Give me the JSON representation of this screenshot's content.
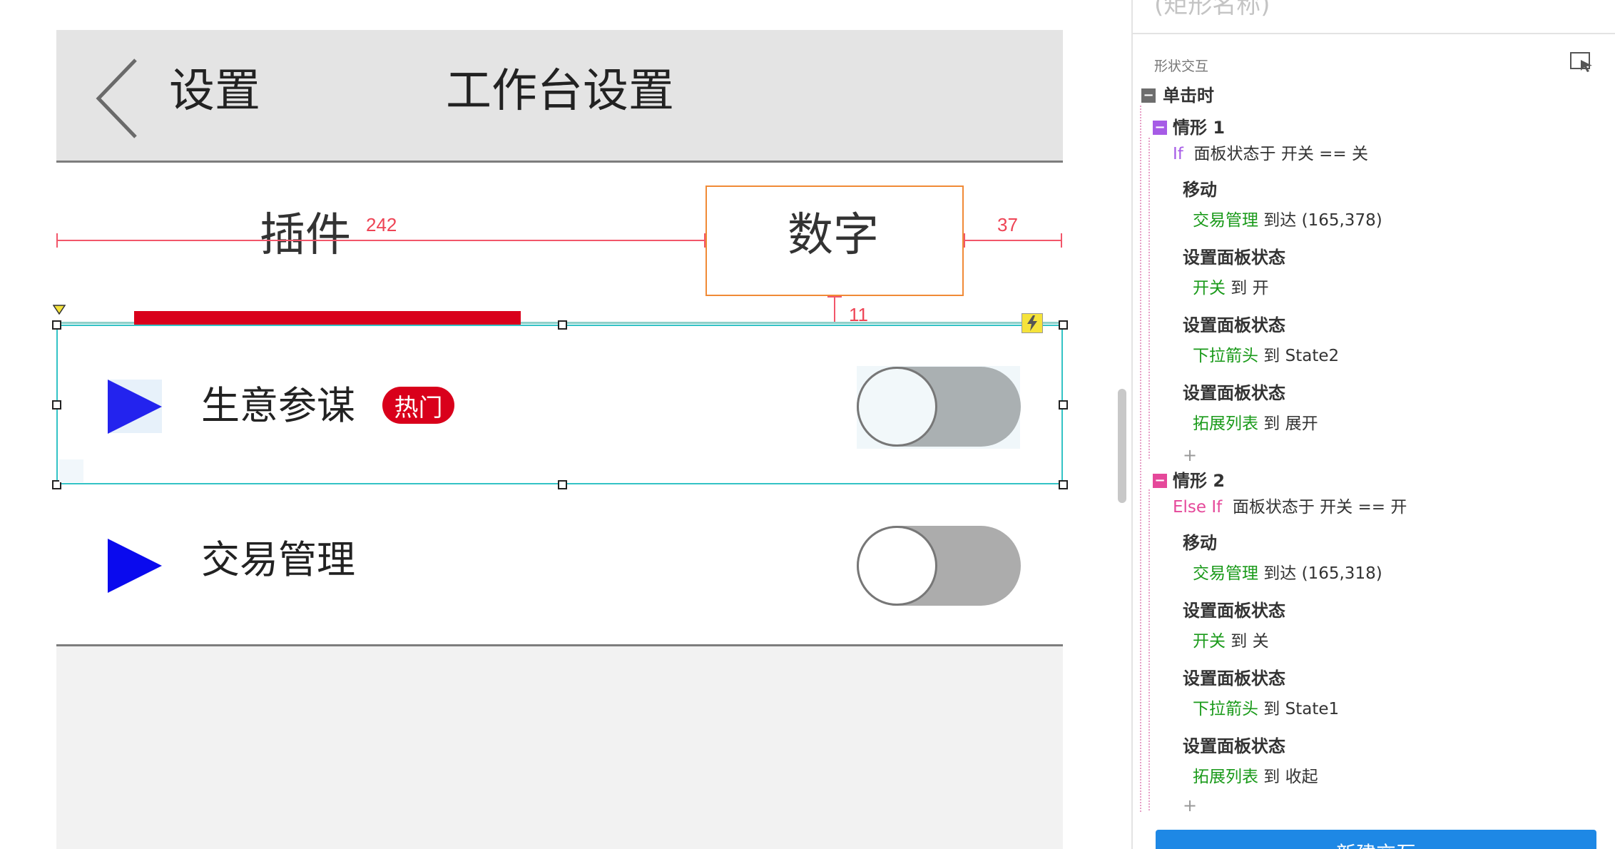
{
  "canvas": {
    "header": {
      "back_label": "设置",
      "title": "工作台设置"
    },
    "tabs": {
      "plugins": "插件",
      "number": "数字"
    },
    "measurements": {
      "left_gap": "242",
      "right_gap": "37",
      "bottom_gap": "11"
    },
    "rows": [
      {
        "label": "生意参谋",
        "badge": "热门",
        "toggle_on": false
      },
      {
        "label": "交易管理",
        "toggle_on": false
      }
    ]
  },
  "panel": {
    "shape_name_placeholder": "(矩形名称)",
    "section_title": "形状交互",
    "event": "单击时",
    "cases": [
      {
        "name": "情形 1",
        "keyword": "If",
        "condition": "面板状态于 开关 == 关",
        "actions": [
          {
            "title": "移动",
            "target": "交易管理",
            "detail": " 到达 (165,378)"
          },
          {
            "title": "设置面板状态",
            "target": "开关",
            "detail": " 到 开"
          },
          {
            "title": "设置面板状态",
            "target": "下拉箭头",
            "detail": " 到 State2"
          },
          {
            "title": "设置面板状态",
            "target": "拓展列表",
            "detail": " 到 展开"
          }
        ]
      },
      {
        "name": "情形 2",
        "keyword": "Else If",
        "condition": "面板状态于 开关 == 开",
        "actions": [
          {
            "title": "移动",
            "target": "交易管理",
            "detail": " 到达 (165,318)"
          },
          {
            "title": "设置面板状态",
            "target": "开关",
            "detail": " 到 关"
          },
          {
            "title": "设置面板状态",
            "target": "下拉箭头",
            "detail": " 到 State1"
          },
          {
            "title": "设置面板状态",
            "target": "拓展列表",
            "detail": " 到 收起"
          }
        ]
      }
    ],
    "add_action": "+",
    "new_interaction_button": "新建交互"
  },
  "colors": {
    "accent_red": "#d9001b",
    "selection_cyan": "#33c3c6",
    "measure_red": "#f2566a",
    "target_green": "#1a9a1a",
    "if_purple": "#a65be6",
    "elseif_pink": "#e5489a",
    "button_blue": "#1e88e5"
  },
  "icons": {
    "back": "chevron-left-icon",
    "row": "play-triangle-icon",
    "lightning": "lightning-icon",
    "corner": "select-corner-icon"
  }
}
